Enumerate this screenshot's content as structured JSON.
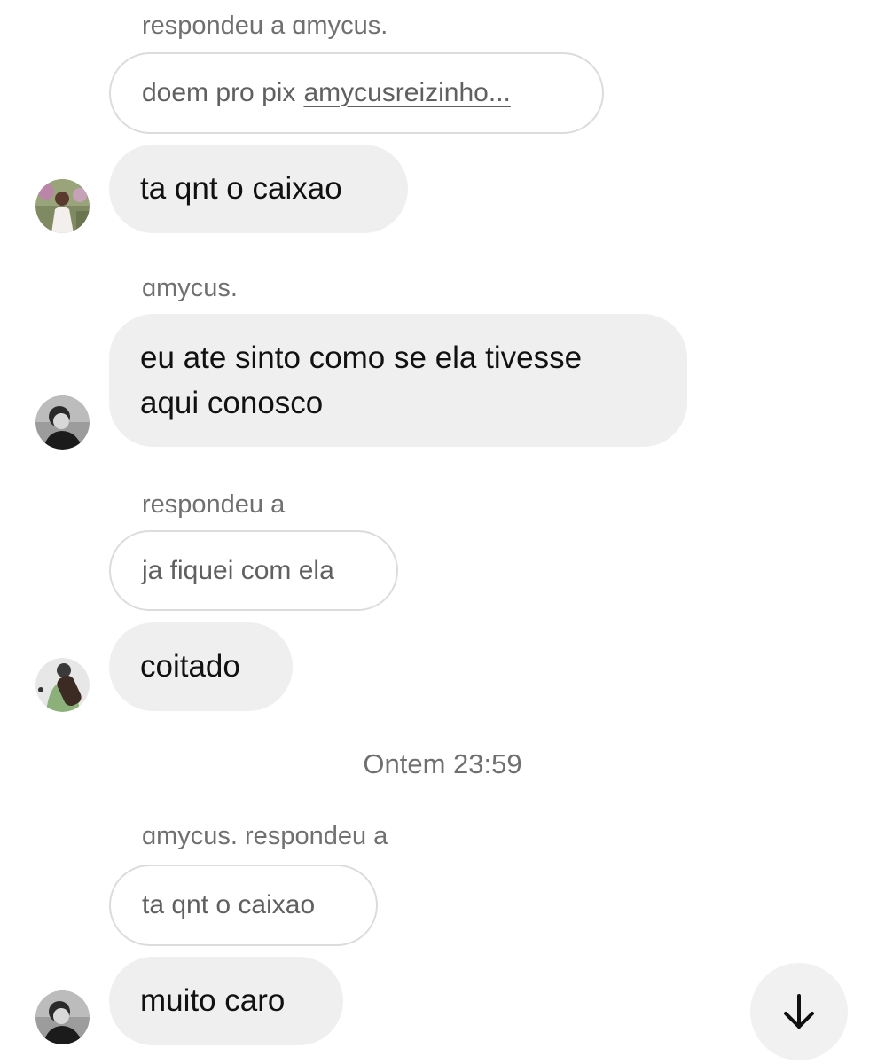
{
  "messages": [
    {
      "reply_label": "respondeu a ɑmycus.",
      "quote_text": "doem pro pix",
      "quote_link": "amycusreizinho...",
      "text": "ta qnt o caixao"
    },
    {
      "sender": "ɑmycus.",
      "text": "eu ate sinto como se ela tivesse aqui conosco"
    },
    {
      "reply_label": "respondeu a",
      "quote_text": "ja fiquei com ela",
      "text": "coitado"
    },
    {
      "reply_label": "ɑmycus. respondeu a",
      "quote_text": "ta qnt o caixao",
      "text": "muito caro"
    }
  ],
  "timestamp": "Ontem 23:59",
  "icons": {
    "scroll_down": "arrow-down-icon"
  },
  "colors": {
    "bubble": "#efefef",
    "quote_border": "#dcdcdc",
    "muted_text": "#707070",
    "background": "#ffffff"
  }
}
